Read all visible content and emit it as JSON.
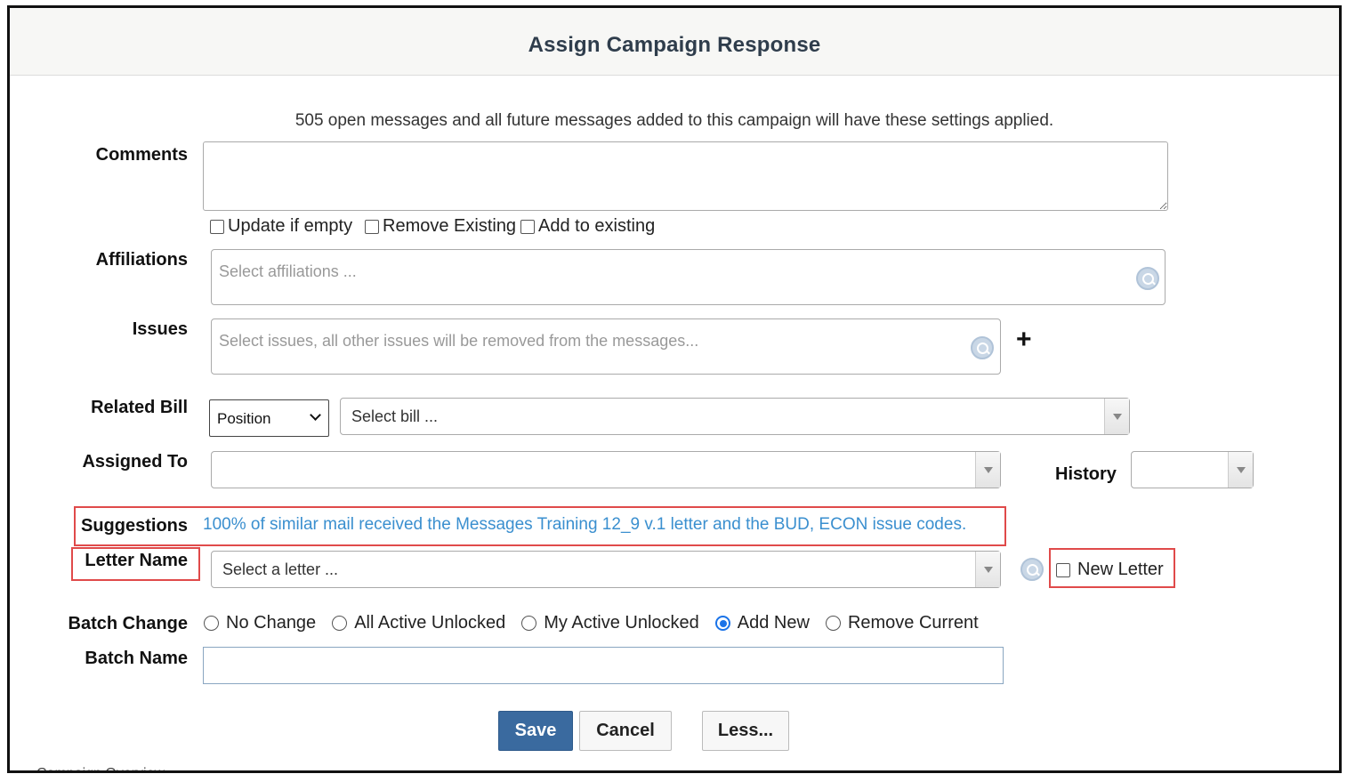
{
  "dialog": {
    "title": "Assign Campaign Response",
    "intro": "505 open messages and all future messages added to this campaign will have these settings applied."
  },
  "comments": {
    "label": "Comments",
    "value": "",
    "options": [
      "Update if empty",
      "Remove Existing",
      "Add to existing"
    ]
  },
  "affiliations": {
    "label": "Affiliations",
    "placeholder": "Select affiliations ..."
  },
  "issues": {
    "label": "Issues",
    "placeholder": "Select issues, all other issues will be removed from the messages..."
  },
  "related_bill": {
    "label": "Related Bill",
    "position_value": "Position",
    "bill_placeholder": "Select bill ..."
  },
  "assigned_to": {
    "label": "Assigned To",
    "value": "",
    "history_label": "History",
    "history_value": ""
  },
  "suggestions": {
    "label": "Suggestions",
    "text": "100% of similar mail received the Messages Training 12_9 v.1 letter and the BUD, ECON issue codes."
  },
  "letter": {
    "label": "Letter Name",
    "placeholder": "Select a letter ...",
    "new_letter_label": "New Letter"
  },
  "batch_change": {
    "label": "Batch Change",
    "options": [
      {
        "label": "No Change",
        "selected": false
      },
      {
        "label": "All Active Unlocked",
        "selected": false
      },
      {
        "label": "My Active Unlocked",
        "selected": false
      },
      {
        "label": "Add New",
        "selected": true
      },
      {
        "label": "Remove Current",
        "selected": false
      }
    ]
  },
  "batch_name": {
    "label": "Batch Name",
    "value": ""
  },
  "buttons": {
    "save": "Save",
    "cancel": "Cancel",
    "less": "Less..."
  },
  "footer_cut": "Campaign Overview"
}
